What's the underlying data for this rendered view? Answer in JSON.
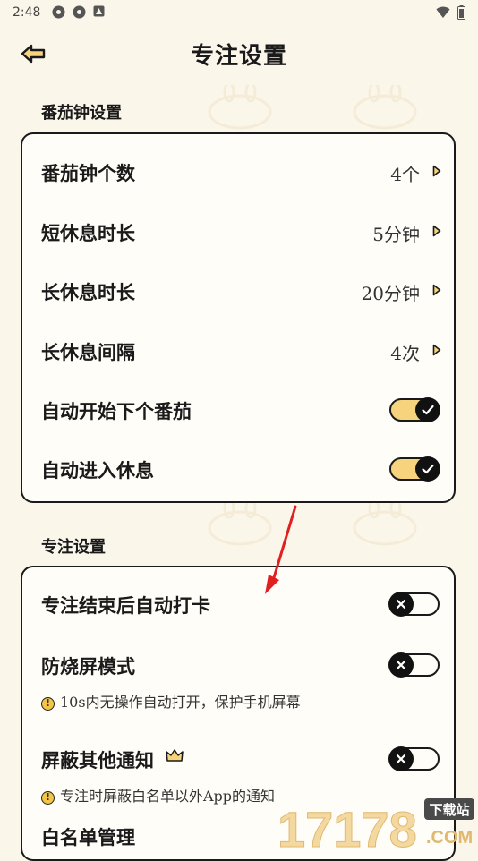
{
  "status_bar": {
    "time": "2:48",
    "icons": [
      "app-notification-icon",
      "app-notification-icon",
      "photo-notification-icon"
    ],
    "right_icons": [
      "wifi-icon",
      "battery-icon"
    ]
  },
  "header": {
    "back_icon": "back-arrow-icon",
    "title": "专注设置"
  },
  "pomodoro_section": {
    "title": "番茄钟设置",
    "rows": [
      {
        "label": "番茄钟个数",
        "value": "4个"
      },
      {
        "label": "短休息时长",
        "value": "5分钟"
      },
      {
        "label": "长休息时长",
        "value": "20分钟"
      },
      {
        "label": "长休息间隔",
        "value": "4次"
      }
    ],
    "toggles": [
      {
        "label": "自动开始下个番茄",
        "on": true
      },
      {
        "label": "自动进入休息",
        "on": true
      }
    ]
  },
  "focus_section": {
    "title": "专注设置",
    "items": [
      {
        "label": "专注结束后自动打卡",
        "on": false
      },
      {
        "label": "防烧屏模式",
        "on": false,
        "note": "10s内无操作自动打开，保护手机屏幕"
      },
      {
        "label": "屏蔽其他通知",
        "on": false,
        "premium_icon": "crown-icon",
        "note": "专注时屏蔽白名单以外App的通知"
      }
    ],
    "whitelist_label": "白名单管理"
  },
  "watermark": {
    "text": "17178",
    "badge": "下载站",
    "domain": ".COM"
  },
  "colors": {
    "background": "#fbf6ea",
    "toggle_on": "#f6d37c",
    "border": "#1a1a1a",
    "warning": "#f3c445",
    "annotation_arrow": "#e02020"
  }
}
